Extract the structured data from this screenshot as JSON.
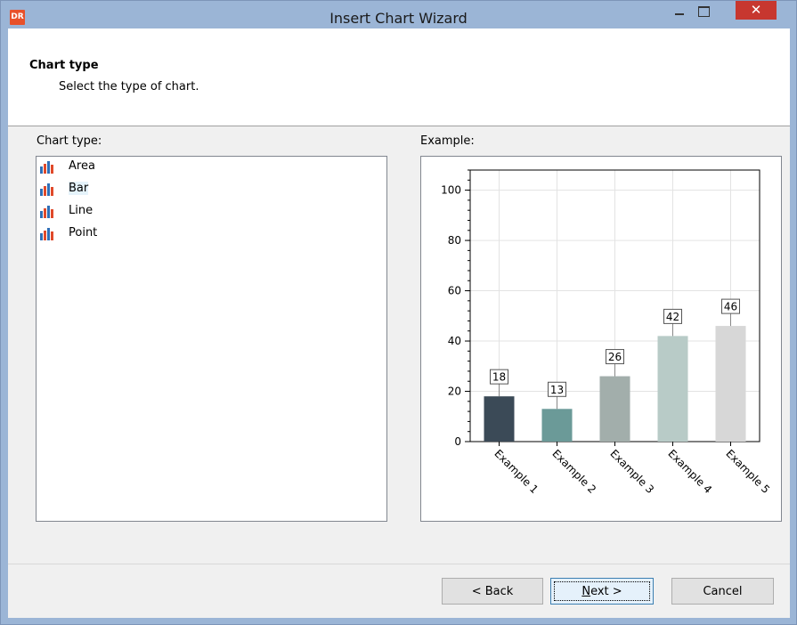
{
  "window": {
    "title": "Insert Chart Wizard",
    "app_icon_text": "DR",
    "close_glyph": "✕"
  },
  "header": {
    "title": "Chart type",
    "subtitle": "Select the type of chart."
  },
  "chart_type_panel": {
    "label": "Chart type:",
    "items": [
      {
        "label": "Area",
        "icon": "chart-bars-icon"
      },
      {
        "label": "Bar",
        "icon": "chart-bars-icon",
        "selected": true
      },
      {
        "label": "Line",
        "icon": "chart-bars-icon"
      },
      {
        "label": "Point",
        "icon": "chart-bars-icon"
      }
    ]
  },
  "example_panel": {
    "label": "Example:"
  },
  "buttons": {
    "back": "< Back",
    "next_mnemonic": "N",
    "next_rest": "ext >",
    "cancel": "Cancel"
  },
  "colors": {
    "titlebar": "#9bb5d6",
    "close_button": "#c7372f",
    "bar_colors": [
      "#3b4a57",
      "#6b9a98",
      "#a2aeab",
      "#b8cbc7",
      "#d7d7d7"
    ]
  },
  "chart_data": {
    "type": "bar",
    "categories": [
      "Example 1",
      "Example 2",
      "Example 3",
      "Example 4",
      "Example 5"
    ],
    "values": [
      18,
      13,
      26,
      42,
      46
    ],
    "ylim": [
      0,
      108
    ],
    "yticks": [
      0,
      20,
      40,
      60,
      80,
      100
    ],
    "data_labels": true,
    "error_bars": true,
    "grid": true,
    "x_label_rotation": "45deg"
  }
}
